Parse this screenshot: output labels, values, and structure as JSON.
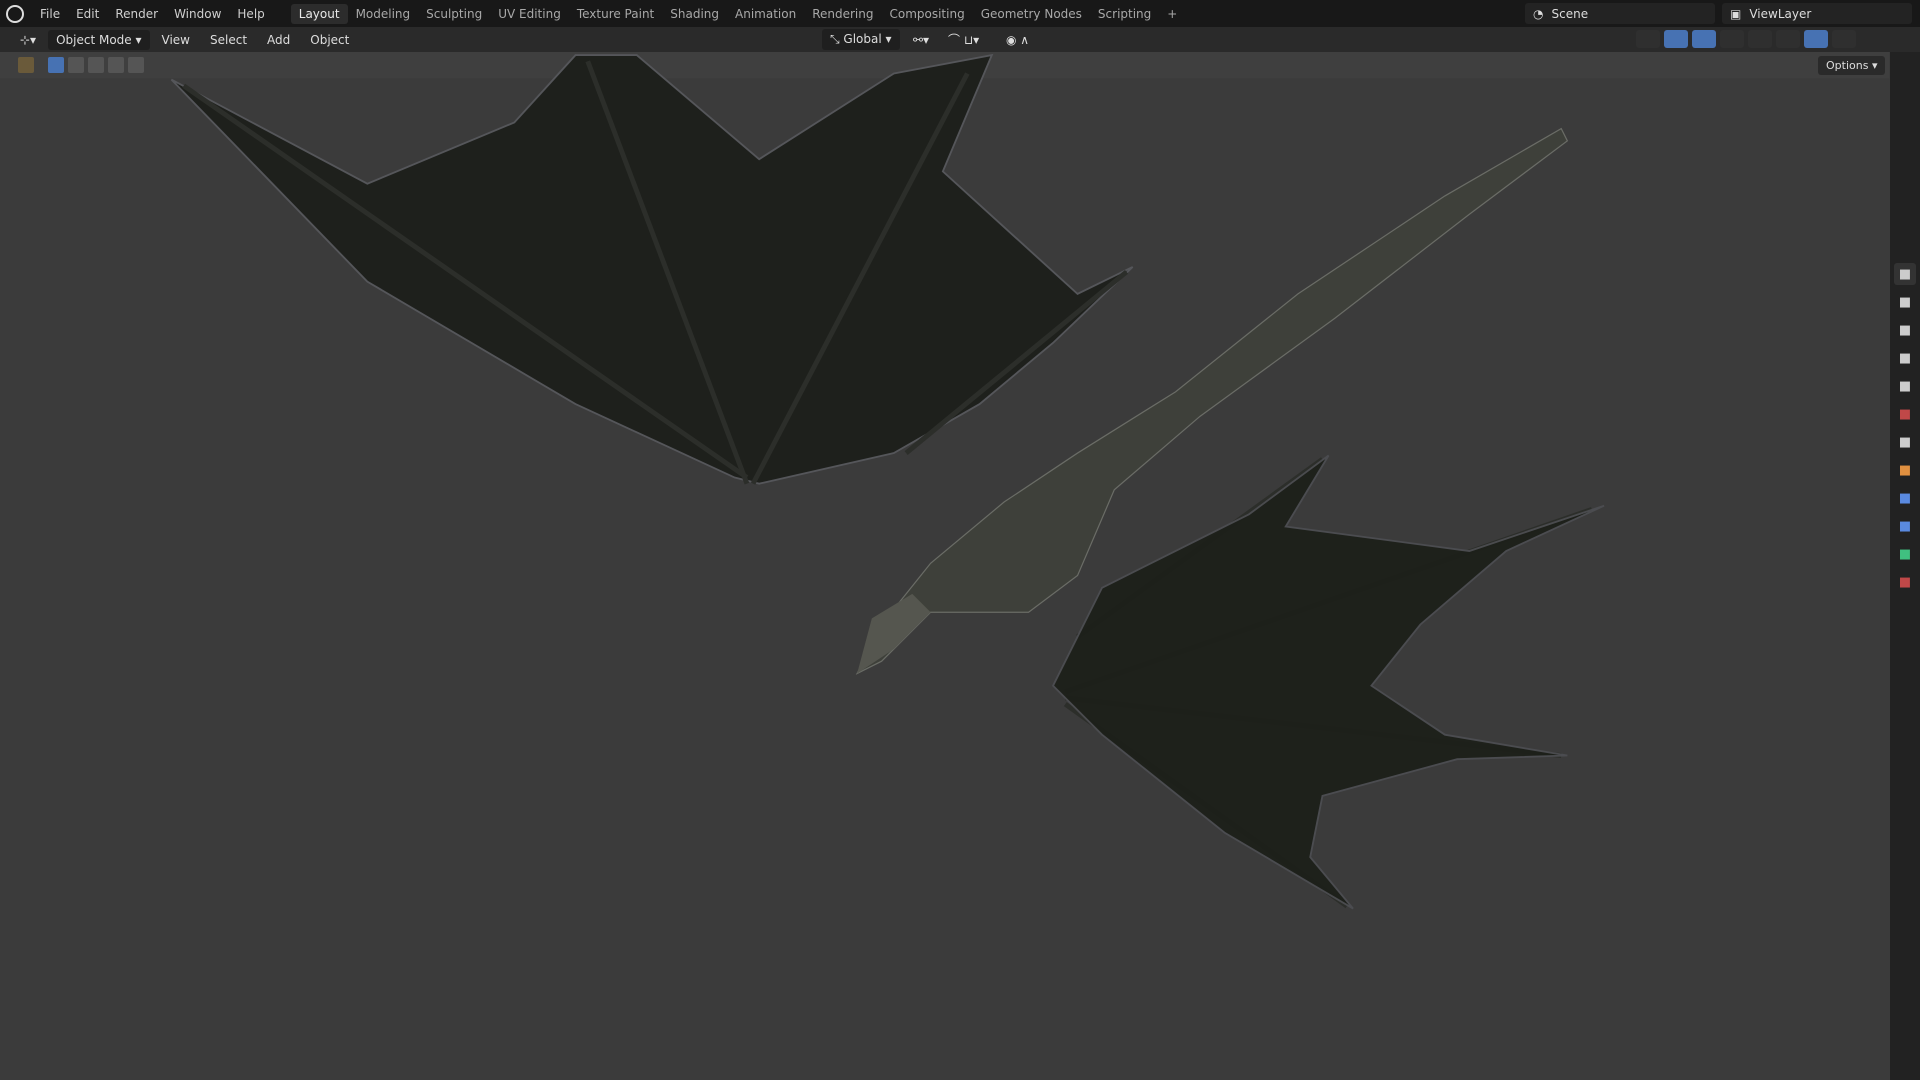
{
  "menu": [
    "File",
    "Edit",
    "Render",
    "Window",
    "Help"
  ],
  "workspaces": [
    "Layout",
    "Modeling",
    "Sculpting",
    "UV Editing",
    "Texture Paint",
    "Shading",
    "Animation",
    "Rendering",
    "Compositing",
    "Geometry Nodes",
    "Scripting",
    "+"
  ],
  "active_workspace": "Layout",
  "scene": "Scene",
  "view_layer": "ViewLayer",
  "header": {
    "mode": "Object Mode",
    "view": "View",
    "select": "Select",
    "add": "Add",
    "object": "Object",
    "orientation": "Global"
  },
  "options_label": "Options",
  "props_tabs": [
    {
      "name": "tool-icon",
      "color": "#ccc"
    },
    {
      "name": "render-icon",
      "color": "#ccc"
    },
    {
      "name": "output-icon",
      "color": "#ccc"
    },
    {
      "name": "view-layer-icon",
      "color": "#ccc"
    },
    {
      "name": "scene-icon",
      "color": "#ccc"
    },
    {
      "name": "world-icon",
      "color": "#c04848"
    },
    {
      "name": "collection-icon",
      "color": "#ccc"
    },
    {
      "name": "object-icon",
      "color": "#e09040"
    },
    {
      "name": "physics-icon",
      "color": "#5a8ae0"
    },
    {
      "name": "constraints-icon",
      "color": "#5a8ae0"
    },
    {
      "name": "data-icon",
      "color": "#40c080"
    },
    {
      "name": "texture-icon",
      "color": "#c04848"
    }
  ]
}
